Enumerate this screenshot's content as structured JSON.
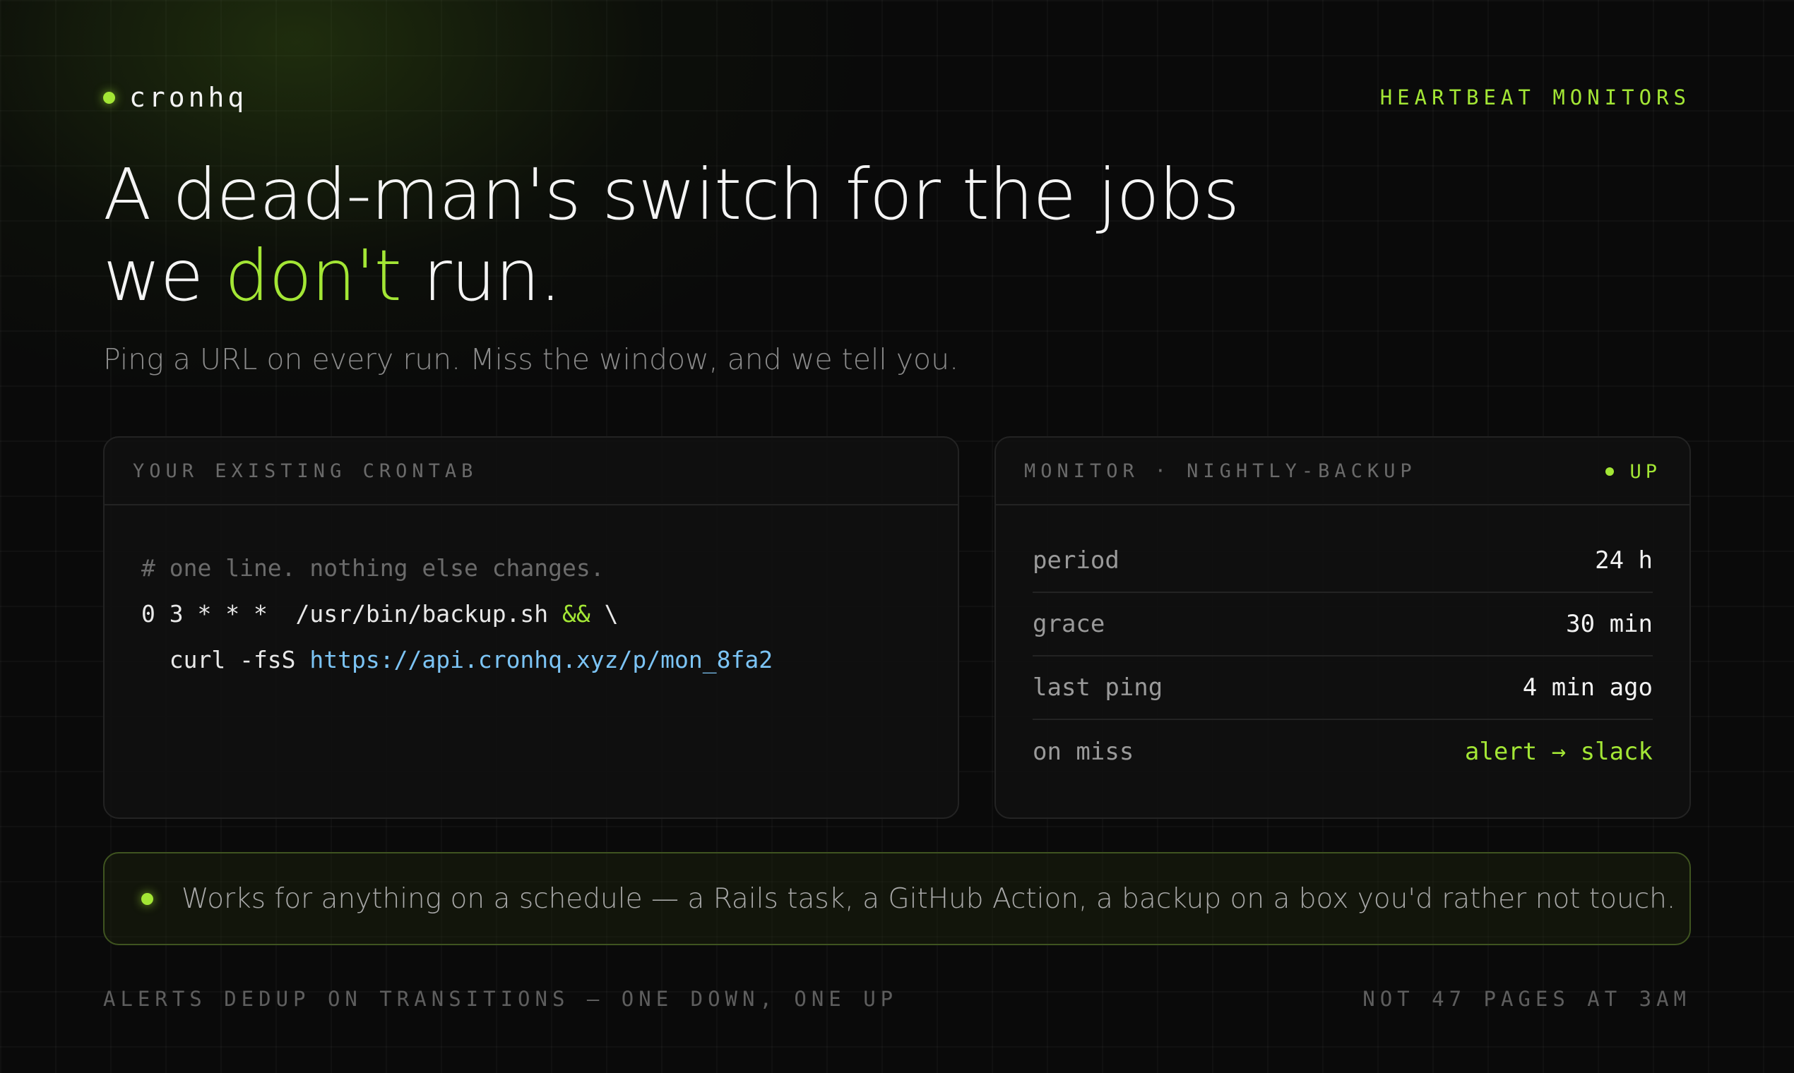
{
  "brand": {
    "name": "cronhq",
    "tagline": "HEARTBEAT MONITORS"
  },
  "hero": {
    "headline_part1": "A dead-man's switch for the jobs",
    "headline_part2": "we ",
    "headline_accent": "don't",
    "headline_part3": " run.",
    "subhead": "Ping a URL on every run. Miss the window, and we tell you."
  },
  "crontab_card": {
    "title": "YOUR EXISTING CRONTAB",
    "comment": "# one line. nothing else changes.",
    "line1_cmd": "0 3 * * *  /usr/bin/backup.sh ",
    "line1_op": "&&",
    "line1_tail": " \\",
    "line2_cmd": "  curl -fsS ",
    "line2_url": "https://api.cronhq.xyz/p/mon_8fa2"
  },
  "monitor_card": {
    "title_label": "MONITOR",
    "title_sep": "·",
    "title_name": "NIGHTLY-BACKUP",
    "status": "UP",
    "rows": [
      {
        "key": "period",
        "value": "24 h"
      },
      {
        "key": "grace",
        "value": "30 min"
      },
      {
        "key": "last ping",
        "value": "4 min ago"
      },
      {
        "key": "on miss",
        "value": "alert → slack"
      }
    ]
  },
  "note": {
    "text": "Works for anything on a schedule — a Rails task, a GitHub Action, a backup on a box you'd rather not touch."
  },
  "footer": {
    "left": "ALERTS DEDUP ON TRANSITIONS — ONE DOWN, ONE UP",
    "right": "NOT 47 PAGES AT 3AM"
  },
  "colors": {
    "background": "#0a0a0a",
    "accent": "#a3e635",
    "url": "#7cc4f5",
    "muted": "#8b8b8b"
  }
}
